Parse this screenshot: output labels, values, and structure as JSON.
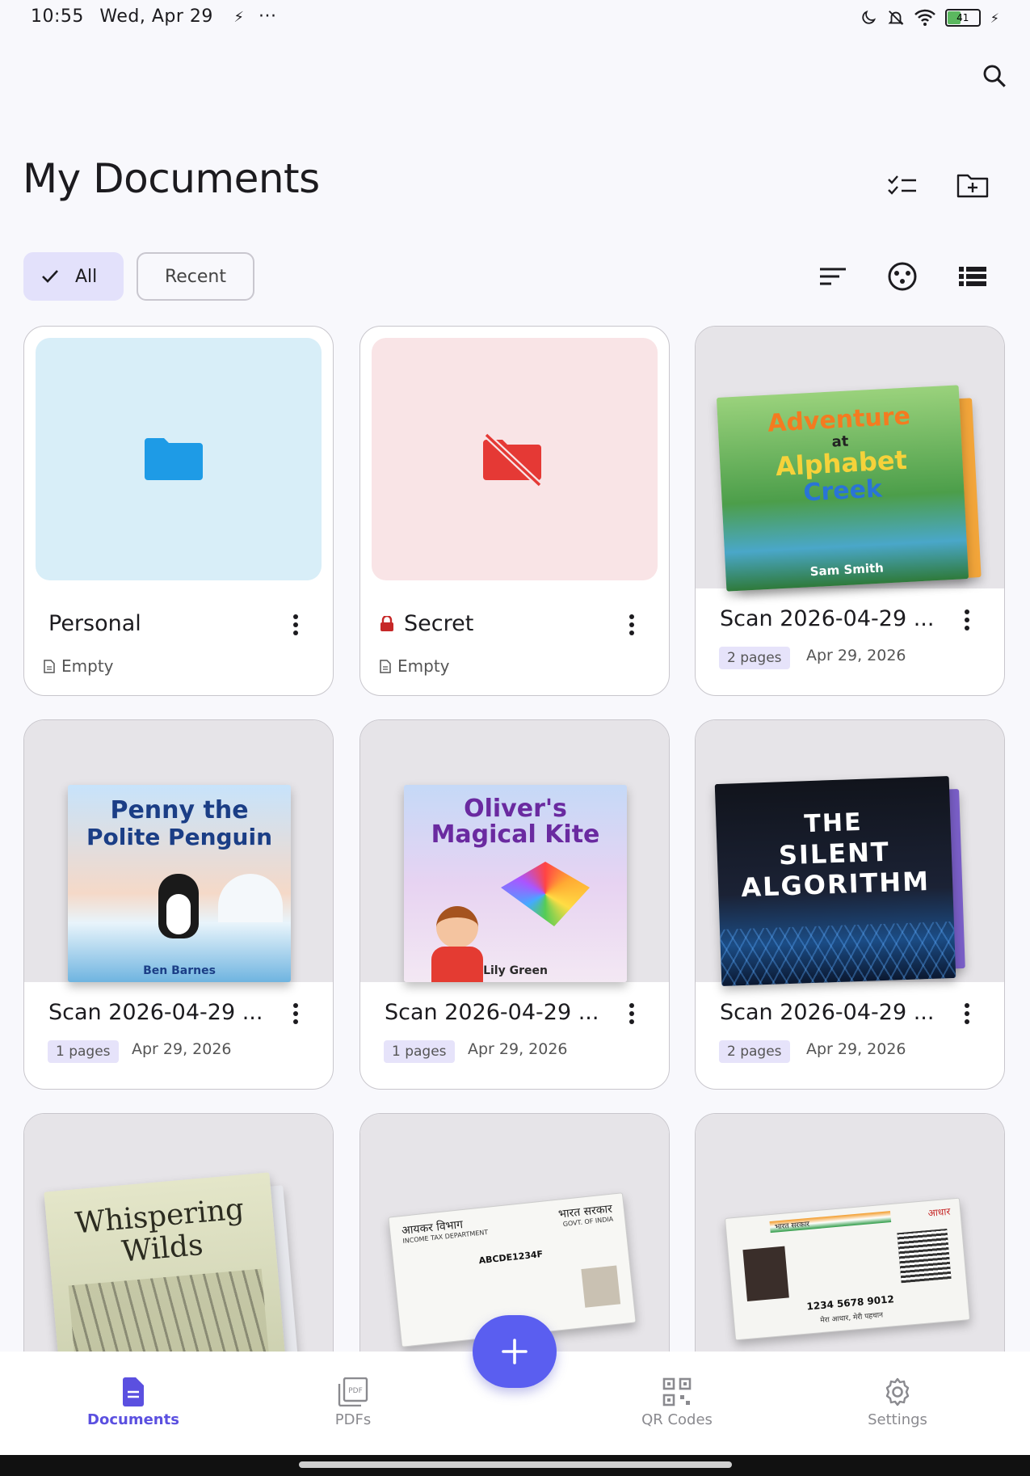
{
  "status_bar": {
    "time": "10:55",
    "date": "Wed, Apr 29",
    "battery_level": 41
  },
  "header": {
    "title": "My Documents"
  },
  "filters": {
    "all_label": "All",
    "recent_label": "Recent",
    "selected": "All"
  },
  "cards": [
    {
      "title": "Personal",
      "meta": "Empty",
      "type": "folder"
    },
    {
      "title": "Secret",
      "meta": "Empty",
      "type": "locked-folder"
    },
    {
      "title": "Scan 2026-04-29 ...",
      "pages": "2 pages",
      "date": "Apr 29, 2026"
    },
    {
      "title": "Scan 2026-04-29 ...",
      "pages": "1 pages",
      "date": "Apr 29, 2026"
    },
    {
      "title": "Scan 2026-04-29 ...",
      "pages": "1 pages",
      "date": "Apr 29, 2026"
    },
    {
      "title": "Scan 2026-04-29 ...",
      "pages": "2 pages",
      "date": "Apr 29, 2026"
    }
  ],
  "covers": {
    "c1": {
      "line1": "Adventure",
      "line2": "at",
      "line3": "Alphabet",
      "line4": "Creek",
      "author": "Sam Smith"
    },
    "c2": {
      "line1": "Penny the",
      "line2": "Polite Penguin",
      "author": "Ben Barnes"
    },
    "c3": {
      "line1": "Oliver's",
      "line2": "Magical Kite",
      "author": "Lily Green"
    },
    "c4": {
      "line1": "THE",
      "line2": "SILENT",
      "line3": "ALGORITHM"
    },
    "c5": {
      "line1": "Whispering",
      "line2": "Wilds"
    },
    "c6": {
      "line1": "आयकर विभाग",
      "line2": "भारत सरकार",
      "line3": "INCOME TAX DEPARTMENT",
      "line4": "GOVT. OF INDIA",
      "line5": "ABCDE1234F"
    },
    "c7": {
      "line1": "भारत सरकार",
      "line2": "1234 5678 9012",
      "line3": "मेरा आधार, मेरी पहचान",
      "line4": "आधार"
    }
  },
  "nav": {
    "documents": "Documents",
    "pdfs": "PDFs",
    "qr_codes": "QR Codes",
    "settings": "Settings",
    "active": "Documents"
  },
  "colors": {
    "accent": "#5a5ef0",
    "chip_selected_bg": "#e3e1fb",
    "folder_blue": "#1e9be6",
    "folder_blue_bg": "#d8eef8",
    "secret_red": "#e53935",
    "secret_bg": "#f9e4e6"
  }
}
